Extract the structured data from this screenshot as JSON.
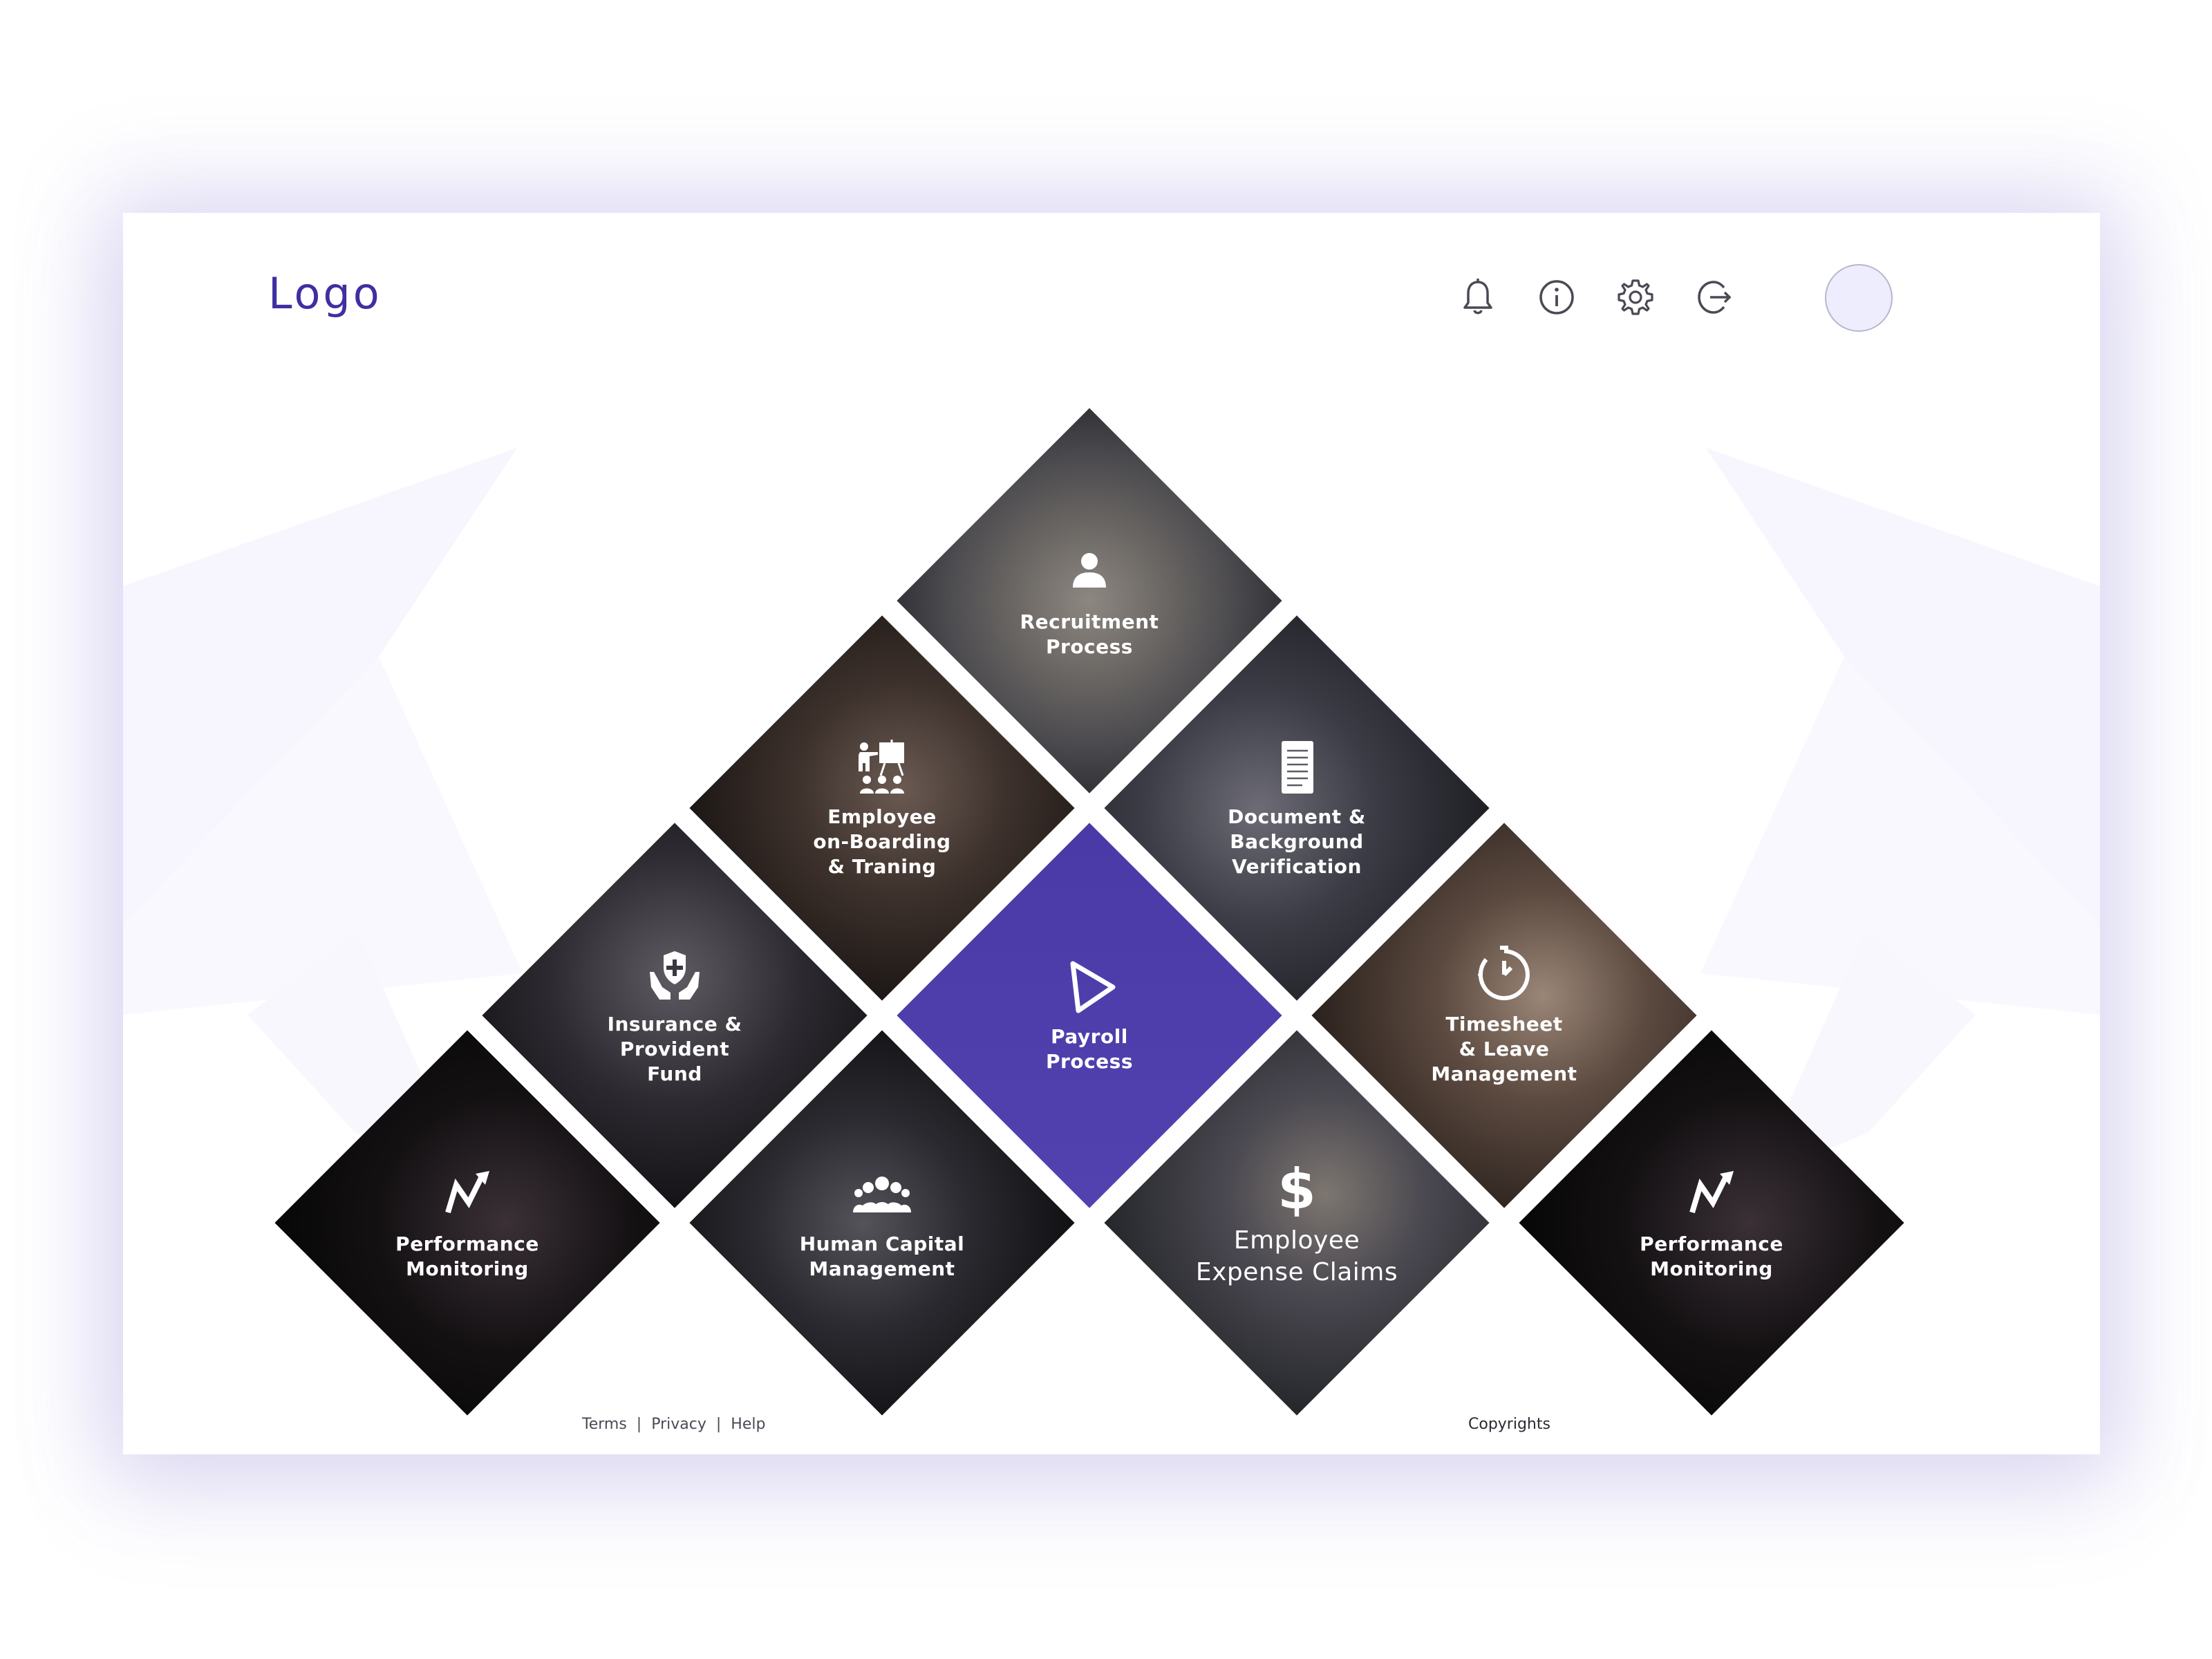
{
  "header": {
    "logo_text": "Logo",
    "icons": [
      "bell-icon",
      "info-icon",
      "gear-icon",
      "logout-icon"
    ]
  },
  "tiles": [
    {
      "id": "recruitment",
      "label": "Recruitment\nProcess",
      "icon": "person-icon"
    },
    {
      "id": "onboarding",
      "label": "Employee\non-Boarding\n& Traning",
      "icon": "presentation-icon"
    },
    {
      "id": "document",
      "label": "Document &\nBackground\nVerification",
      "icon": "document-icon"
    },
    {
      "id": "insurance",
      "label": "Insurance &\nProvident\nFund",
      "icon": "shield-hands-icon"
    },
    {
      "id": "payroll",
      "label": "Payroll\nProcess",
      "icon": "play-triangle-icon"
    },
    {
      "id": "timesheet",
      "label": "Timesheet\n& Leave\nManagement",
      "icon": "stopwatch-icon"
    },
    {
      "id": "performance-left",
      "label": "Performance\nMonitoring",
      "icon": "trend-arrow-icon"
    },
    {
      "id": "human-capital",
      "label": "Human Capital\nManagement",
      "icon": "group-icon"
    },
    {
      "id": "expense",
      "label": "Employee\nExpense Claims",
      "icon": "dollar-icon"
    },
    {
      "id": "performance-right",
      "label": "Performance\nMonitoring",
      "icon": "trend-arrow-icon"
    }
  ],
  "footer": {
    "terms": "Terms",
    "privacy": "Privacy",
    "help": "Help",
    "separator": "|",
    "copyright": "Copyrights"
  },
  "colors": {
    "accent": "#3f2fa0",
    "payroll_tile": "#4a3aa8",
    "background_shape": "#f6f5fe",
    "avatar_fill": "#ededfd"
  }
}
